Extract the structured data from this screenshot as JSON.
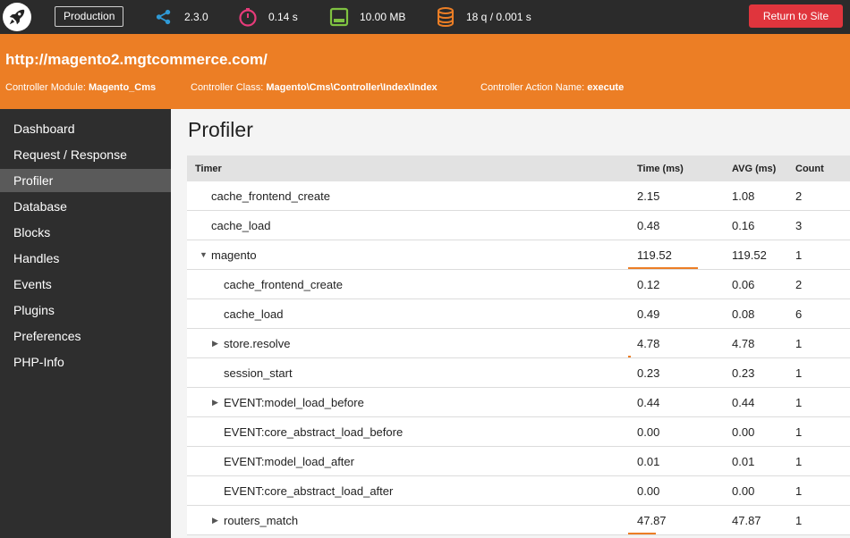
{
  "topbar": {
    "env_button": "Production",
    "stats": [
      {
        "icon": "share-icon",
        "value": "2.3.0",
        "color": "#2f9ad6"
      },
      {
        "icon": "stopwatch-icon",
        "value": "0.14 s",
        "color": "#e63b7a"
      },
      {
        "icon": "memory-icon",
        "value": "10.00 MB",
        "color": "#7fc241"
      },
      {
        "icon": "database-icon",
        "value": "18 q / 0.001 s",
        "color": "#ec7e25"
      }
    ],
    "return_button": "Return to Site"
  },
  "header": {
    "url": "http://magento2.mgtcommerce.com/",
    "module_label": "Controller Module:",
    "module_value": "Magento_Cms",
    "class_label": "Controller Class:",
    "class_value": "Magento\\Cms\\Controller\\Index\\Index",
    "action_label": "Controller Action Name:",
    "action_value": "execute",
    "accent": "#ec7e25"
  },
  "sidebar": {
    "items": [
      {
        "label": "Dashboard"
      },
      {
        "label": "Request / Response"
      },
      {
        "label": "Profiler",
        "active": true
      },
      {
        "label": "Database"
      },
      {
        "label": "Blocks"
      },
      {
        "label": "Handles"
      },
      {
        "label": "Events"
      },
      {
        "label": "Plugins"
      },
      {
        "label": "Preferences"
      },
      {
        "label": "PHP-Info"
      }
    ]
  },
  "main": {
    "title": "Profiler",
    "columns": {
      "timer": "Timer",
      "time": "Time (ms)",
      "avg": "AVG (ms)",
      "count": "Count"
    },
    "rows": [
      {
        "timer": "cache_frontend_create",
        "level": 1,
        "toggle": "",
        "time": "2.15",
        "avg": "1.08",
        "count": "2",
        "time_bar_percent": 0
      },
      {
        "timer": "cache_load",
        "level": 1,
        "toggle": "",
        "time": "0.48",
        "avg": "0.16",
        "count": "3",
        "time_bar_percent": 0
      },
      {
        "timer": "magento",
        "level": 1,
        "toggle": "▼",
        "time": "119.52",
        "avg": "119.52",
        "count": "1",
        "time_bar_percent": 100
      },
      {
        "timer": "cache_frontend_create",
        "level": 2,
        "toggle": "",
        "time": "0.12",
        "avg": "0.06",
        "count": "2",
        "time_bar_percent": 0
      },
      {
        "timer": "cache_load",
        "level": 2,
        "toggle": "",
        "time": "0.49",
        "avg": "0.08",
        "count": "6",
        "time_bar_percent": 0
      },
      {
        "timer": "store.resolve",
        "level": 2,
        "toggle": "▶",
        "time": "4.78",
        "avg": "4.78",
        "count": "1",
        "time_bar_percent": 4
      },
      {
        "timer": "session_start",
        "level": 2,
        "toggle": "",
        "time": "0.23",
        "avg": "0.23",
        "count": "1",
        "time_bar_percent": 0
      },
      {
        "timer": "EVENT:model_load_before",
        "level": 2,
        "toggle": "▶",
        "time": "0.44",
        "avg": "0.44",
        "count": "1",
        "time_bar_percent": 0
      },
      {
        "timer": "EVENT:core_abstract_load_before",
        "level": 2,
        "toggle": "",
        "time": "0.00",
        "avg": "0.00",
        "count": "1",
        "time_bar_percent": 0
      },
      {
        "timer": "EVENT:model_load_after",
        "level": 2,
        "toggle": "",
        "time": "0.01",
        "avg": "0.01",
        "count": "1",
        "time_bar_percent": 0
      },
      {
        "timer": "EVENT:core_abstract_load_after",
        "level": 2,
        "toggle": "",
        "time": "0.00",
        "avg": "0.00",
        "count": "1",
        "time_bar_percent": 0
      },
      {
        "timer": "routers_match",
        "level": 2,
        "toggle": "▶",
        "time": "47.87",
        "avg": "47.87",
        "count": "1",
        "time_bar_percent": 40
      }
    ]
  }
}
